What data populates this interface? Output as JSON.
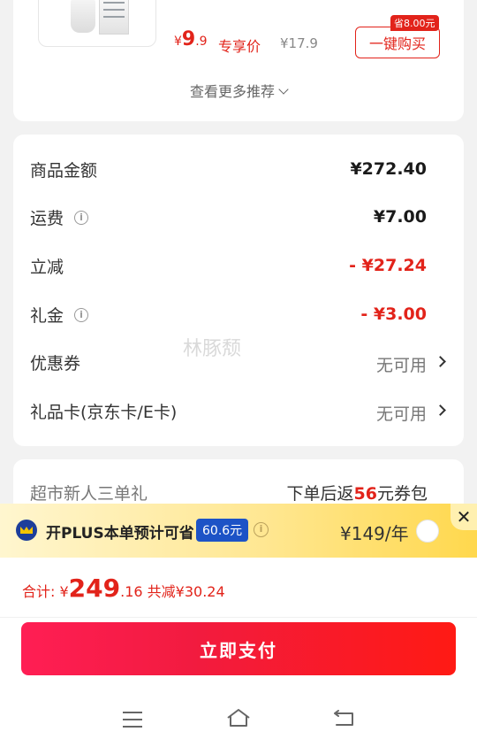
{
  "recommendation": {
    "price_symbol": "¥",
    "price_int": "9",
    "price_dec": ".9",
    "price_label": "专享价",
    "original_price": "¥17.9",
    "save_badge": "省8.00元",
    "buy_button": "一键购买",
    "more_link": "查看更多推荐"
  },
  "summary": {
    "rows": [
      {
        "label": "商品金额",
        "value": "¥272.40"
      },
      {
        "label": "运费",
        "value": "¥7.00"
      },
      {
        "label": "立减",
        "value": "- ¥27.24"
      },
      {
        "label": "礼金",
        "value": "- ¥3.00"
      },
      {
        "label": "优惠券",
        "value": "无可用"
      },
      {
        "label": "礼品卡(京东卡/E卡)",
        "value": "无可用"
      }
    ],
    "watermark": "林豚颓"
  },
  "newcomer": {
    "label": "超市新人三单礼",
    "value_prefix": "下单后返",
    "value_amount": "56",
    "value_suffix": "元券包"
  },
  "plus": {
    "text": "开PLUS本单预计可省",
    "savings": "60.6元",
    "price": "¥149/年",
    "close": "✕"
  },
  "pay": {
    "total_label": "合计: ",
    "currency": "¥",
    "total_int": "249",
    "total_dec": ".16",
    "discount_text": "共减¥30.24",
    "pay_button": "立即支付"
  },
  "colors": {
    "accent": "#e2231a",
    "plus_blue": "#1d53c6"
  }
}
